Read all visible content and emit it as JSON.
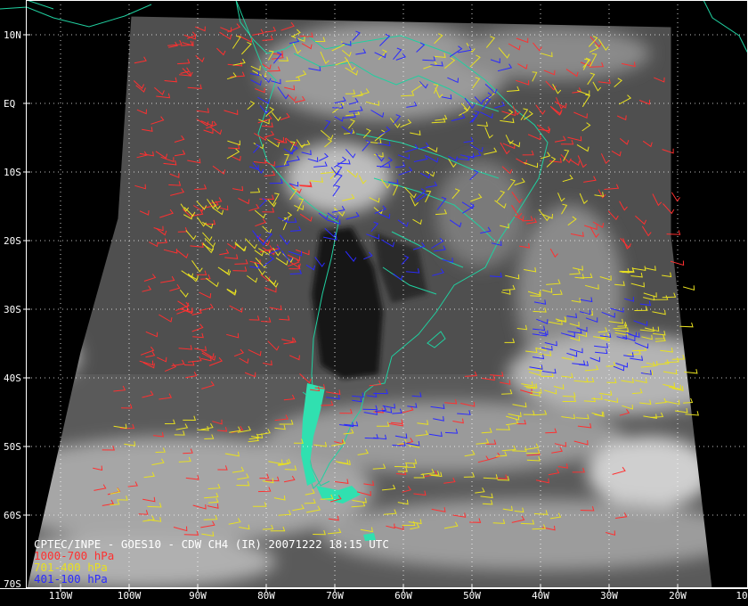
{
  "map": {
    "title": "CPTEC/INPE - GOES10 - CDW CH4 (IR) 20071222 18:15 UTC",
    "legend": [
      {
        "label": "1000-700 hPa",
        "color": "#ff3030"
      },
      {
        "label": "701-400 hPa",
        "color": "#e8e020"
      },
      {
        "label": "401-100 hPa",
        "color": "#2a2aff"
      }
    ],
    "lat_labels": [
      "10N",
      "EQ",
      "10S",
      "20S",
      "30S",
      "40S",
      "50S",
      "60S",
      "70S"
    ],
    "lon_labels": [
      "110W",
      "100W",
      "90W",
      "80W",
      "70W",
      "60W",
      "50W",
      "40W",
      "30W",
      "20W",
      "10"
    ],
    "coastline_color": "#20d0a0",
    "grid_color": "#ffffff"
  }
}
